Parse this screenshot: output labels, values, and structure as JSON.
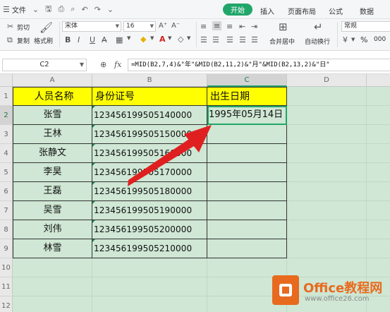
{
  "menubar": {
    "file_label": "文件",
    "tabs": [
      "开始",
      "插入",
      "页面布局",
      "公式",
      "数据"
    ],
    "active_tab": "开始"
  },
  "ribbon": {
    "cut_label": "剪切",
    "copy_label": "复制",
    "format_painter_label": "格式刷",
    "font_name": "宋体",
    "font_size": "16",
    "merge_label": "合并居中",
    "wrap_label": "自动换行",
    "number_format": "常规",
    "percent_symbol": "%",
    "comma_symbol": "000"
  },
  "formula_bar": {
    "cell_ref": "C2",
    "fx_label": "fx",
    "formula": "=MID(B2,7,4)&\"年\"&MID(B2,11,2)&\"月\"&MID(B2,13,2)&\"日\""
  },
  "grid": {
    "columns": [
      "A",
      "B",
      "C",
      "D"
    ],
    "row_numbers": [
      "1",
      "2",
      "3",
      "4",
      "5",
      "6",
      "7",
      "8",
      "9",
      "10",
      "11",
      "12"
    ],
    "headers": [
      "人员名称",
      "身份证号",
      "出生日期"
    ],
    "rows": [
      {
        "name": "张雪",
        "id": "123456199505140000",
        "date": "1995年05月14日"
      },
      {
        "name": "王林",
        "id": "123456199505150000",
        "date": ""
      },
      {
        "name": "张静文",
        "id": "123456199505160000",
        "date": ""
      },
      {
        "name": "李昊",
        "id": "123456199505170000",
        "date": ""
      },
      {
        "name": "王磊",
        "id": "123456199505180000",
        "date": ""
      },
      {
        "name": "吴雪",
        "id": "123456199505190000",
        "date": ""
      },
      {
        "name": "刘伟",
        "id": "123456199505200000",
        "date": ""
      },
      {
        "name": "林雪",
        "id": "123456199505210000",
        "date": ""
      }
    ],
    "selected_cell": "C2"
  },
  "watermark": {
    "brand": "Office教程网",
    "url": "www.office26.com"
  },
  "colors": {
    "accent_green": "#21a66a",
    "header_fill": "#ffff00",
    "sheet_bg": "#cfe7d4",
    "arrow_red": "#e02020",
    "logo_orange": "#e86a1e"
  }
}
